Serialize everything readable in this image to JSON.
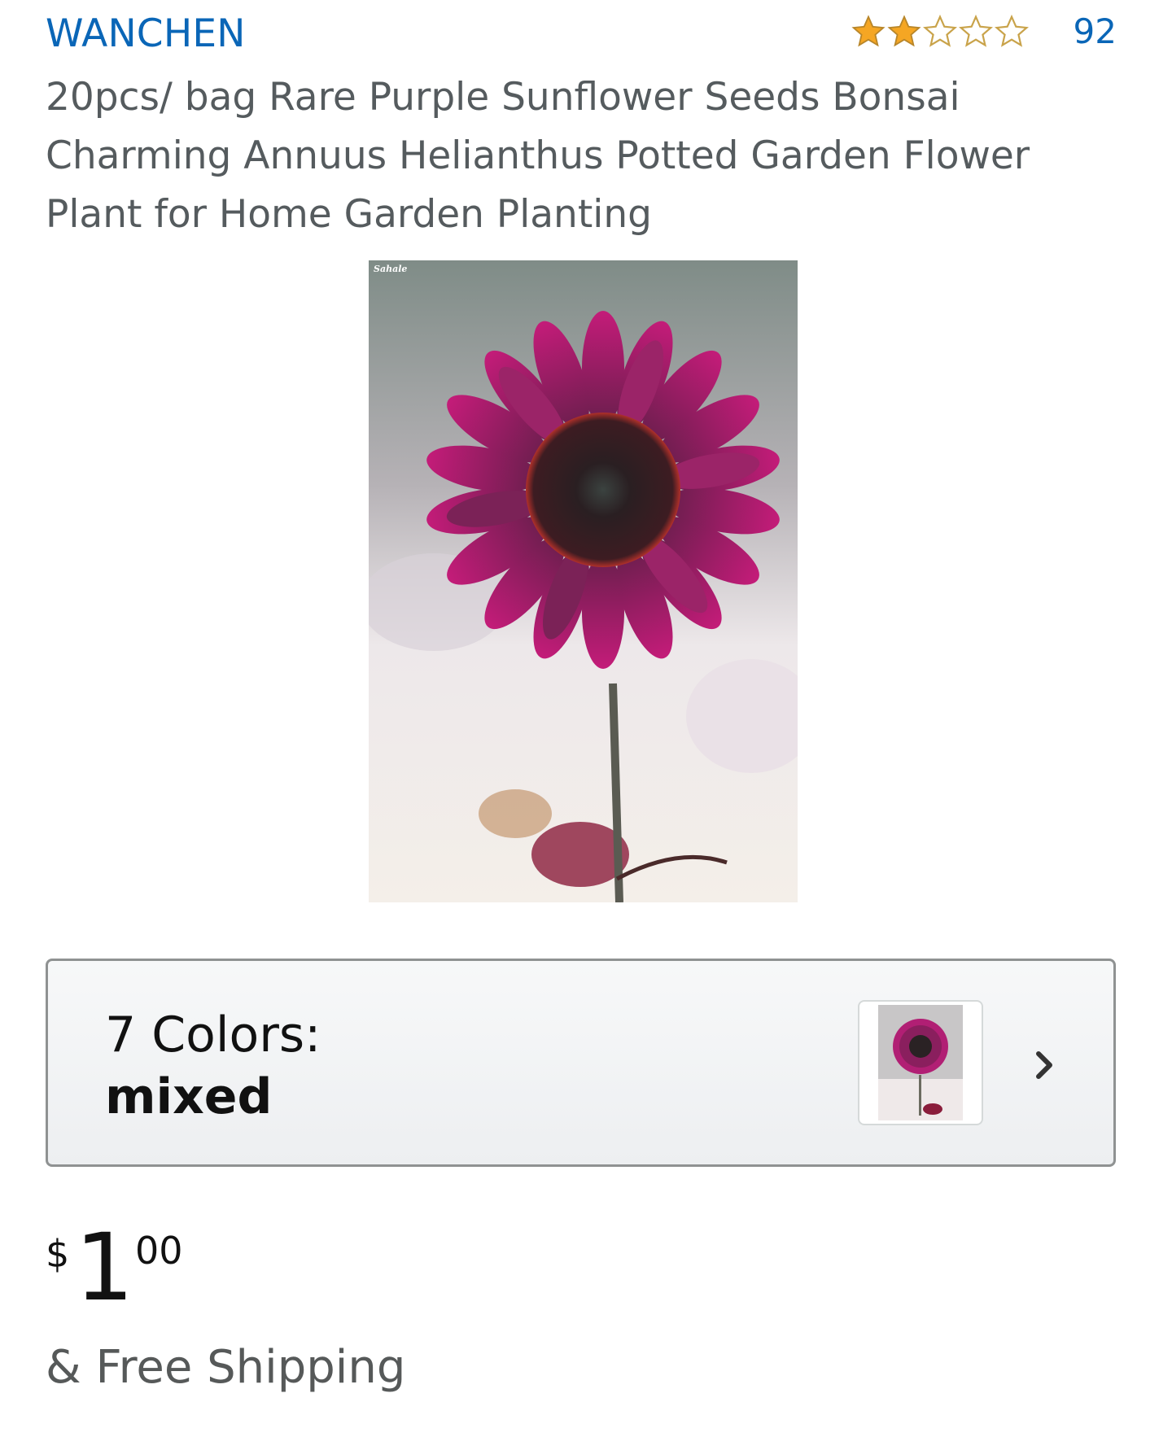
{
  "product": {
    "brand": "WANCHEN",
    "rating": {
      "stars": 2,
      "max_stars": 5,
      "review_count": "92",
      "star_color": "#f5a623",
      "empty_star_color": "#c9a34a"
    },
    "title": "20pcs/ bag Rare Purple Sunflower Seeds Bonsai Charming Annuus Helianthus Potted Garden Flower Plant for Home Garden Planting",
    "image": {
      "subject": "purple-sunflower-photo",
      "watermark": "Sahale"
    },
    "variation": {
      "label": "7 Colors:",
      "value": "mixed",
      "chevron_icon": "chevron-right-icon"
    },
    "price": {
      "symbol": "$",
      "whole": "1",
      "fraction": "00"
    },
    "shipping": "& Free Shipping"
  },
  "colors": {
    "link": "#0a66b7",
    "text": "#565959",
    "dark_text": "#111111",
    "box_border": "#8f9292"
  }
}
